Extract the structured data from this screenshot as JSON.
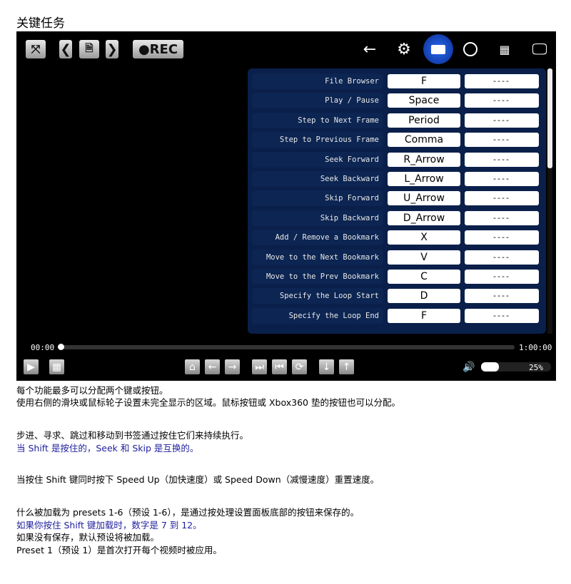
{
  "title": "关键任务",
  "toolbar": {
    "rec_label": "●REC"
  },
  "bindings": [
    {
      "action": "File Browser",
      "key1": "F",
      "key2": "----"
    },
    {
      "action": "Play / Pause",
      "key1": "Space",
      "key2": "----"
    },
    {
      "action": "Step to Next Frame",
      "key1": "Period",
      "key2": "----"
    },
    {
      "action": "Step to Previous Frame",
      "key1": "Comma",
      "key2": "----"
    },
    {
      "action": "Seek Forward",
      "key1": "R_Arrow",
      "key2": "----"
    },
    {
      "action": "Seek Backward",
      "key1": "L_Arrow",
      "key2": "----"
    },
    {
      "action": "Skip Forward",
      "key1": "U_Arrow",
      "key2": "----"
    },
    {
      "action": "Skip Backward",
      "key1": "D_Arrow",
      "key2": "----"
    },
    {
      "action": "Add / Remove a Bookmark",
      "key1": "X",
      "key2": "----"
    },
    {
      "action": "Move to the Next Bookmark",
      "key1": "V",
      "key2": "----"
    },
    {
      "action": "Move to the Prev Bookmark",
      "key1": "C",
      "key2": "----"
    },
    {
      "action": "Specify the Loop Start",
      "key1": "D",
      "key2": "----"
    },
    {
      "action": "Specify the Loop End",
      "key1": "F",
      "key2": "----"
    }
  ],
  "player": {
    "current_time": "00:00",
    "duration": "1:00:00",
    "progress": 0,
    "volume_percent": 25,
    "volume_label": "25%"
  },
  "colors": {
    "accent": "#1a56d6",
    "panel": "#0a1f4a",
    "note_blue": "#1f1f9e"
  },
  "notes": [
    "每个功能最多可以分配两个键或按钮。",
    "使用右侧的滑块或鼠标轮子设置未完全显示的区域。鼠标按钮或 Xbox360 垫的按钮也可以分配。",
    "步进、寻求、跳过和移动到书签通过按住它们来持续执行。",
    "当 Shift 是按住的，Seek 和 Skip 是互换的。",
    "当按住 Shift 键同时按下 Speed Up（加快速度）或 Speed Down（减慢速度）重置速度。",
    "什么被加载为 presets 1-6（预设 1-6），是通过按处理设置面板底部的按钮来保存的。",
    "如果你按住 Shift 键加载时，数字是 7 到 12。",
    "如果没有保存，默认预设将被加载。",
    "Preset 1（预设 1）是首次打开每个视频时被应用。"
  ]
}
